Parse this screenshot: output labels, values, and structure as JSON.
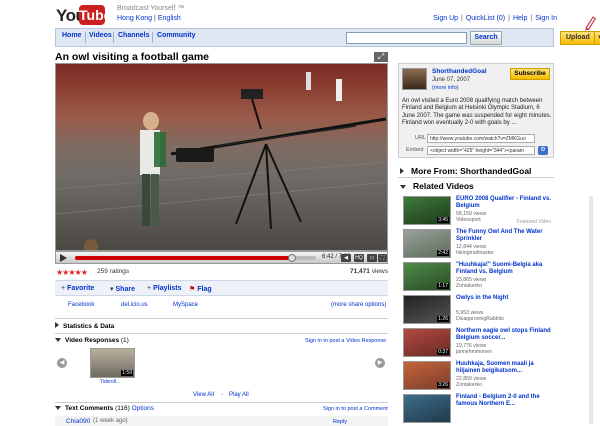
{
  "header": {
    "logo_you": "You",
    "logo_tube": "Tube",
    "tagline": "Broadcast Yourself ™",
    "region": "Hong Kong",
    "language": "English",
    "links": [
      "Sign Up",
      "QuickList (0)",
      "Help",
      "Sign In"
    ]
  },
  "nav": {
    "tabs": [
      "Home",
      "Videos",
      "Channels",
      "Community"
    ],
    "search_value": "",
    "search_button": "Search",
    "upload_button": "Upload"
  },
  "video": {
    "title": "An owl visiting a football game",
    "time": "6:42 / 7:28",
    "progress_fraction": 0.9,
    "hq_label": "HQ",
    "rating_stars": "★★★★★",
    "ratings": "259 ratings",
    "views_number": "71,471",
    "views_label": "views"
  },
  "actions": {
    "favorite": "Favorite",
    "share": "Share",
    "playlists": "Playlists",
    "flag": "Flag",
    "share_targets": [
      "Facebook",
      "del.icio.us",
      "MySpace"
    ],
    "more_share": "(more share options)"
  },
  "sections": {
    "stats": "Statistics & Data",
    "responses": "Video Responses",
    "responses_count": "(1)",
    "post_response": "Sign in to post a Video Response",
    "response_thumb_caption": "Tidsroll...",
    "response_thumb_dur": "1:59",
    "view_all": "View All",
    "play_all": "Play All",
    "comments": "Text Comments",
    "comments_count": "(116)",
    "options": "Options",
    "post_comment": "Sign in to post a Comment",
    "first_commenter": "Chia090",
    "first_comment_time": "(1 week ago)",
    "reply": "Reply"
  },
  "channel": {
    "name": "ShorthandedGoal",
    "date": "June 07, 2007",
    "more_info": "(more info)",
    "subscribe": "Subscribe",
    "description": "An owl visited a Euro 2008 qualifying match between Finland and Belgium at Helsinki Olympic Stadium, 6 June 2007. The game was suspended for eight minutes. Finland won eventually 2-0 with goals by ...",
    "url_label": "URL",
    "url_value": "http://www.youtube.com/watch?v=ZMKGuo",
    "embed_label": "Embed",
    "embed_value": "<object width=\"425\" height=\"344\"><param"
  },
  "right": {
    "more_from": "More From: ShorthandedGoal",
    "related": "Related Videos",
    "featured_label": "Featured Video",
    "videos": [
      {
        "title": "EURO 2008 Qualifier - Finland vs. Belgium",
        "views": "58,159 views",
        "author": "Videosport",
        "duration": "3:45",
        "c1": "#3f7a3a",
        "c2": "#1d3b1c"
      },
      {
        "title": "The Funny Owl And The Water Sprinkler",
        "views": "12,844 views",
        "author": "hikingtrailmaster",
        "duration": "2:42",
        "c1": "#9aa29a",
        "c2": "#5b6b5a"
      },
      {
        "title": "\"Huuhkaja!\" Suomi-Belgia aka Finland vs. Belgium",
        "views": "23,865 views",
        "author": "Zontakerko",
        "duration": "1:17",
        "c1": "#4d8c46",
        "c2": "#2a4a27"
      },
      {
        "title": "Owlys in the Night",
        "views": "5,953 views",
        "author": "DisapprovingRabbits",
        "duration": "1:26",
        "c1": "#222222",
        "c2": "#555555"
      },
      {
        "title": "Northern eagle owl stops Finland Belgium soccer...",
        "views": "19,776 views",
        "author": "jannehmmonen",
        "duration": "0:37",
        "c1": "#b04a40",
        "c2": "#6a2a25"
      },
      {
        "title": "Huuhkaja, Suomen maali ja hiljainen belgikatsom...",
        "views": "22,859 views",
        "author": "Zontakerko",
        "duration": "3:26",
        "c1": "#c4643a",
        "c2": "#7b3e2a"
      },
      {
        "title": "Finland - Belgium 2-0 and the famous Northern E...",
        "views": "",
        "author": "",
        "duration": "",
        "c1": "#3d6e8a",
        "c2": "#20394a"
      }
    ]
  },
  "colors": {
    "link": "#0033cc",
    "brand_red": "#cc1f1f",
    "subscribe_yellow": "#f7bb00",
    "nav_bg": "#dfe7f3"
  }
}
